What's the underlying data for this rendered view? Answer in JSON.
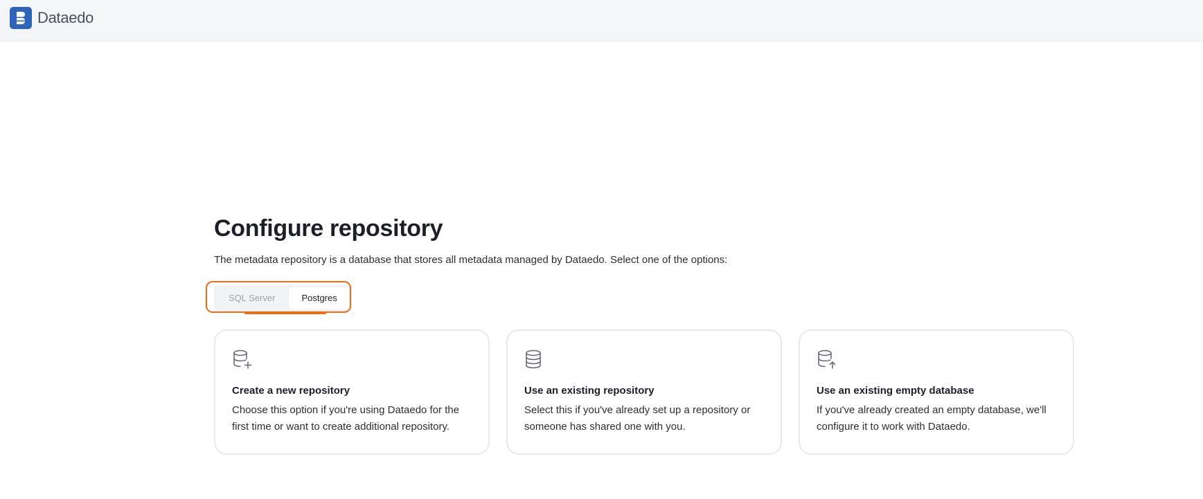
{
  "app": {
    "name": "Dataedo"
  },
  "page": {
    "title": "Configure repository",
    "subtitle": "The metadata repository is a database that stores all metadata managed by Dataedo. Select one of the options:"
  },
  "db_type_toggle": {
    "options": [
      {
        "label": "SQL Server",
        "selected": false
      },
      {
        "label": "Postgres",
        "selected": true
      }
    ]
  },
  "cards": [
    {
      "icon": "database-plus-icon",
      "title": "Create a new repository",
      "description": "Choose this option if you're using Dataedo for the first time or want to create additional repository."
    },
    {
      "icon": "database-icon",
      "title": "Use an existing repository",
      "description": "Select this if you've already set up a repository or someone has shared one with you."
    },
    {
      "icon": "database-upload-icon",
      "title": "Use an existing empty database",
      "description": "If you've already created an empty database, we'll configure it to work with Dataedo."
    }
  ],
  "colors": {
    "brand": "#2f64b8",
    "annotation": "#ee6b1a",
    "header_bg": "#f4f5f7"
  }
}
